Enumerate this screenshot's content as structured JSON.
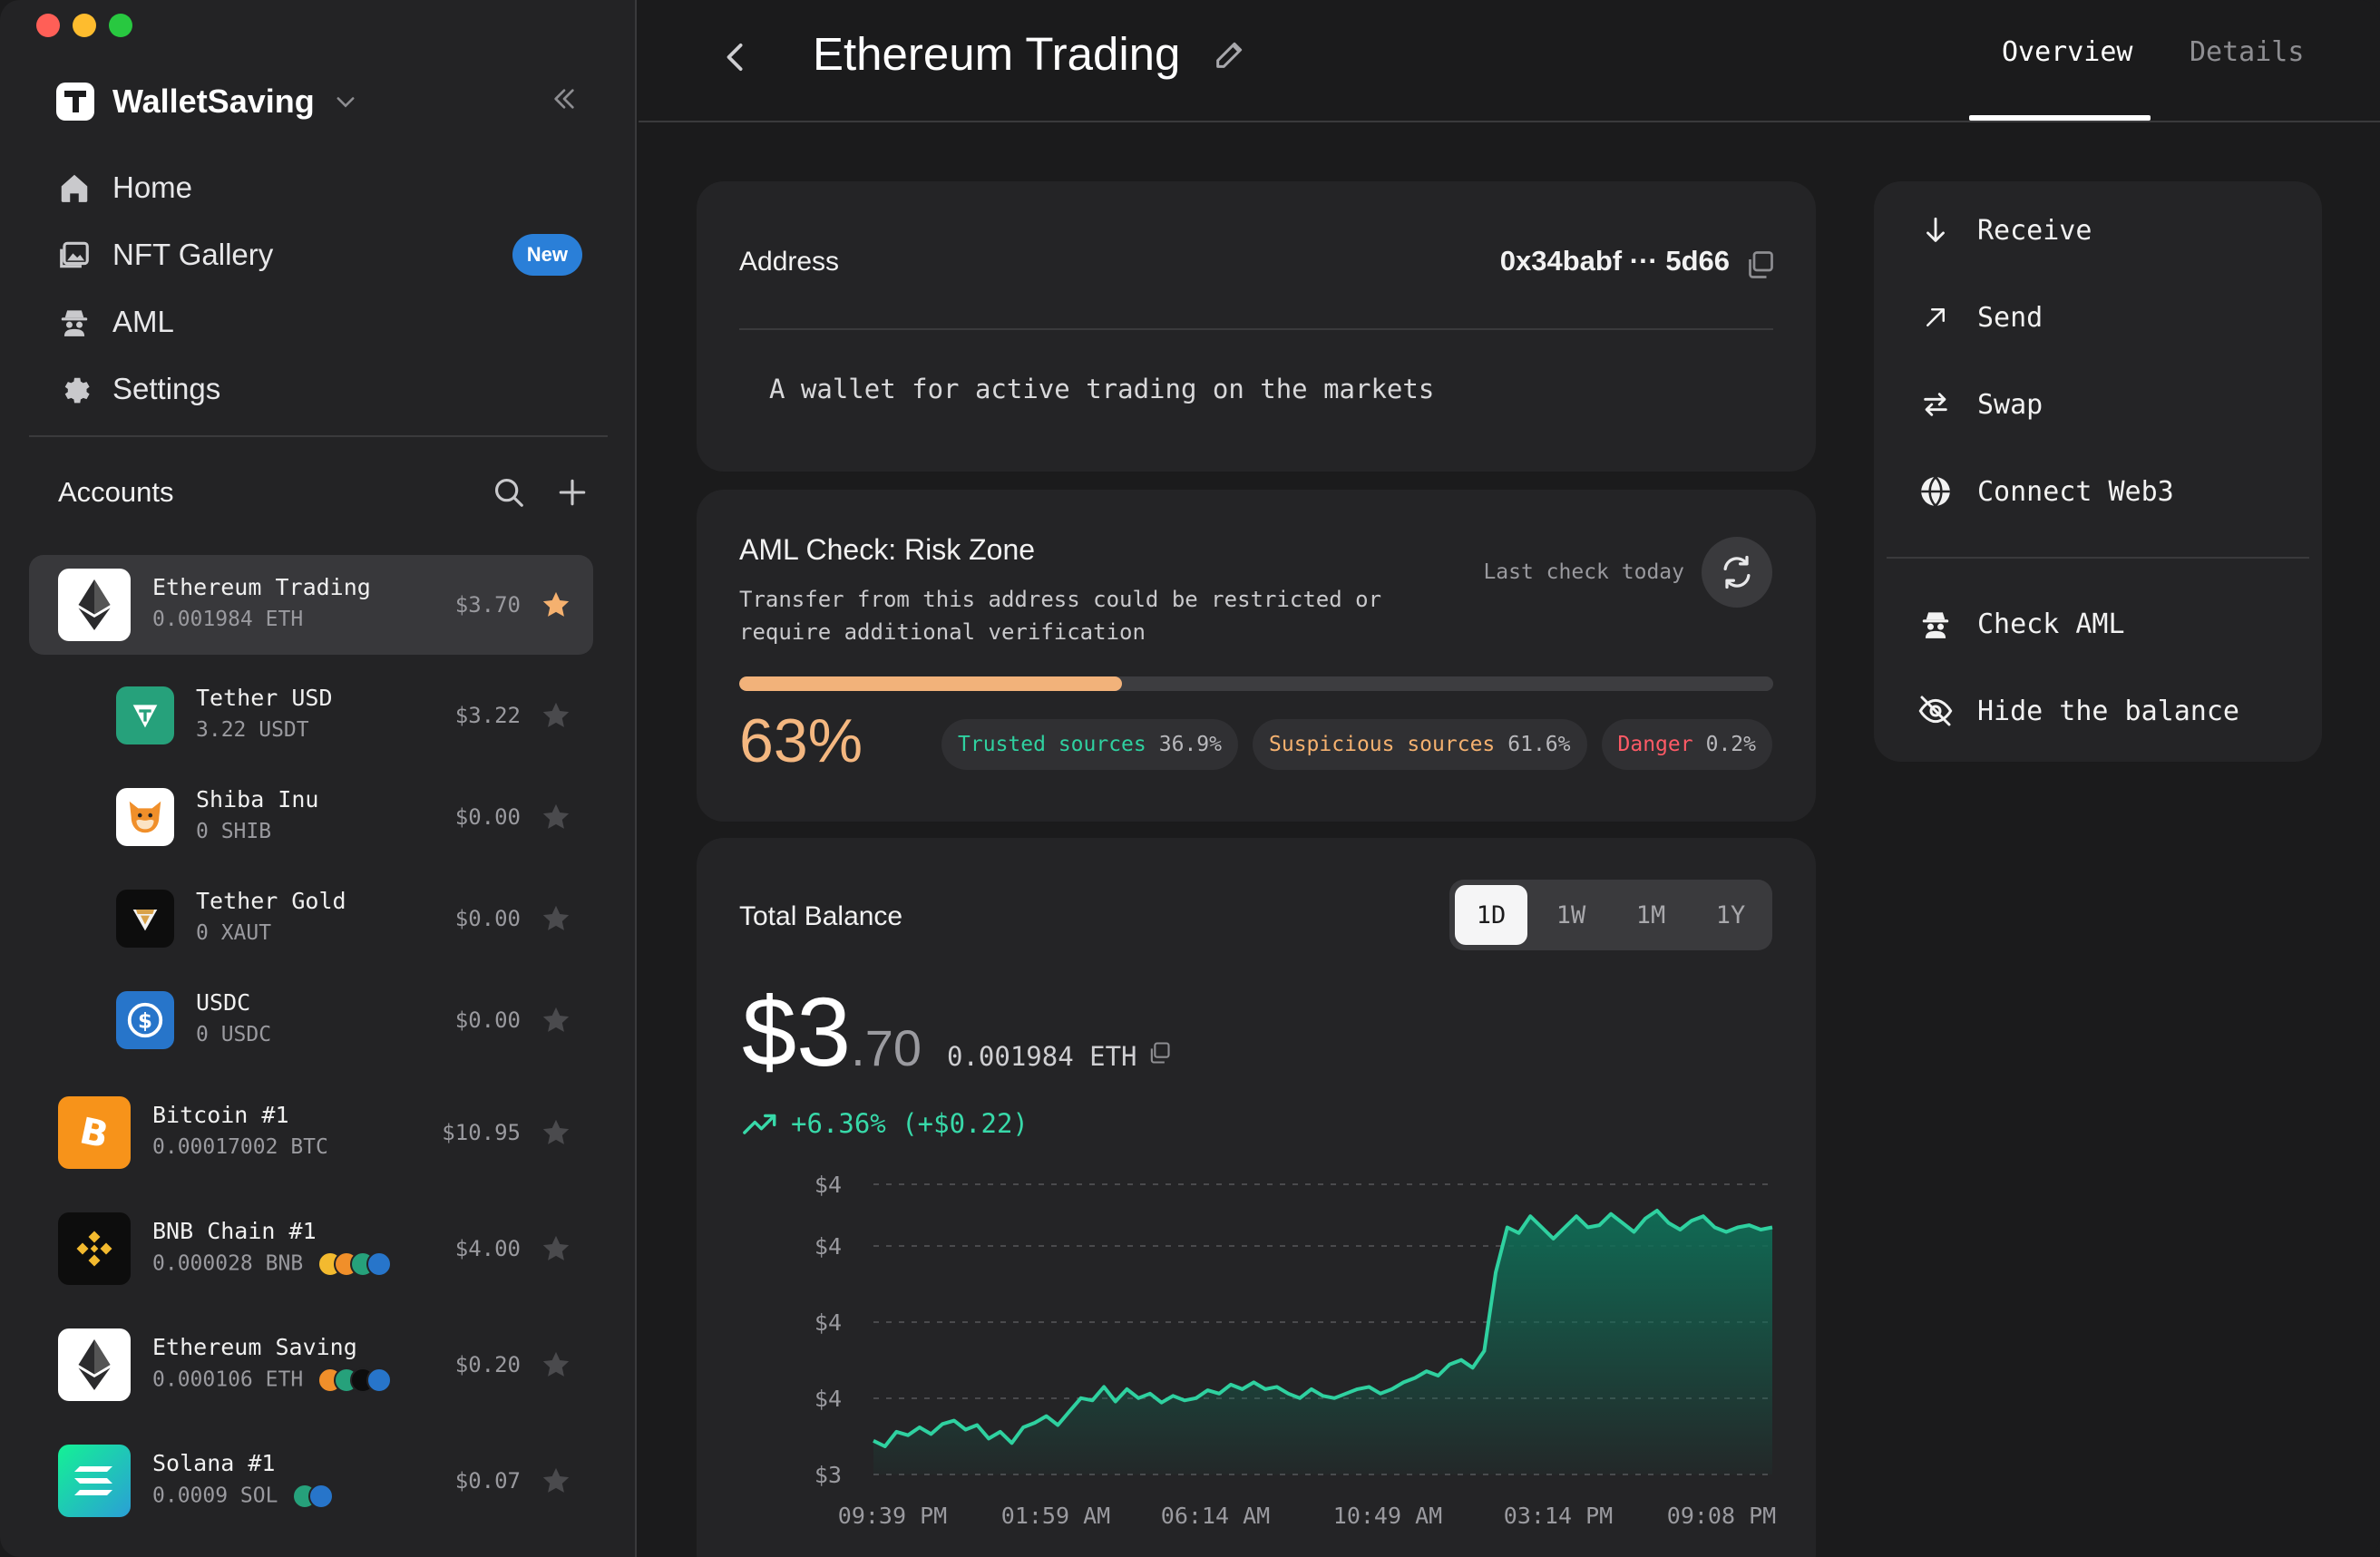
{
  "window": {
    "traffic_lights": [
      "#ff5f57",
      "#febc2e",
      "#28c840"
    ]
  },
  "sidebar": {
    "brand": "WalletSaving",
    "nav": [
      {
        "label": "Home",
        "icon": "home-icon"
      },
      {
        "label": "NFT Gallery",
        "icon": "gallery-icon",
        "badge": "New"
      },
      {
        "label": "AML",
        "icon": "spy-icon"
      },
      {
        "label": "Settings",
        "icon": "gear-icon"
      }
    ],
    "accounts_title": "Accounts",
    "accounts": [
      {
        "name": "Ethereum Trading",
        "amount": "0.001984 ETH",
        "usd": "$3.70",
        "starred": true,
        "active": true
      },
      {
        "name": "Tether USD",
        "amount": "3.22 USDT",
        "usd": "$3.22"
      },
      {
        "name": "Shiba Inu",
        "amount": "0 SHIB",
        "usd": "$0.00"
      },
      {
        "name": "Tether Gold",
        "amount": "0 XAUT",
        "usd": "$0.00"
      },
      {
        "name": "USDC",
        "amount": "0 USDC",
        "usd": "$0.00"
      },
      {
        "name": "Bitcoin #1",
        "amount": "0.00017002 BTC",
        "usd": "$10.95"
      },
      {
        "name": "BNB Chain #1",
        "amount": "0.000028 BNB",
        "usd": "$4.00"
      },
      {
        "name": "Ethereum Saving",
        "amount": "0.000106 ETH",
        "usd": "$0.20"
      },
      {
        "name": "Solana #1",
        "amount": "0.0009 SOL",
        "usd": "$0.07"
      }
    ]
  },
  "header": {
    "title": "Ethereum Trading",
    "tabs": [
      {
        "label": "Overview",
        "active": true
      },
      {
        "label": "Details"
      }
    ]
  },
  "address_card": {
    "label": "Address",
    "value": "0x34babf ··· 5d66",
    "description": "A wallet for active trading on the markets"
  },
  "aml_card": {
    "title": "AML Check: Risk Zone",
    "description": "Transfer from this address could be restricted or require additional verification",
    "last_check": "Last check today",
    "risk_fraction": 0.37,
    "percent": "63%",
    "chips": [
      {
        "label": "Trusted sources",
        "value": "36.9%",
        "color": "#2fd1a0"
      },
      {
        "label": "Suspicious sources",
        "value": "61.6%",
        "color": "#f5b16f"
      },
      {
        "label": "Danger",
        "value": "0.2%",
        "color": "#ff5a66"
      }
    ]
  },
  "balance_card": {
    "label": "Total Balance",
    "ranges": [
      "1D",
      "1W",
      "1M",
      "1Y"
    ],
    "active_range": "1D",
    "balance_int": "$3",
    "balance_dec": ".70",
    "balance_eth": "0.001984 ETH",
    "change": "+6.36% (+$0.22)"
  },
  "chart_data": {
    "type": "area",
    "title": "",
    "xlabel": "",
    "ylabel": "",
    "y_tick_labels": [
      "$4",
      "$4",
      "$4",
      "$4",
      "$3"
    ],
    "x_tick_labels": [
      "09:39 PM",
      "01:59 AM",
      "06:14 AM",
      "10:49 AM",
      "03:14 PM",
      "09:08 PM"
    ],
    "ylim": [
      3.48,
      3.74
    ],
    "grid": true,
    "color": "#2fd1a0",
    "series": [
      {
        "values": [
          3.51,
          3.505,
          3.518,
          3.515,
          3.522,
          3.516,
          3.525,
          3.528,
          3.52,
          3.524,
          3.512,
          3.518,
          3.508,
          3.522,
          3.526,
          3.532,
          3.524,
          3.536,
          3.548,
          3.546,
          3.558,
          3.545,
          3.556,
          3.548,
          3.552,
          3.544,
          3.55,
          3.546,
          3.548,
          3.555,
          3.552,
          3.56,
          3.556,
          3.562,
          3.556,
          3.558,
          3.552,
          3.548,
          3.556,
          3.55,
          3.548,
          3.552,
          3.556,
          3.558,
          3.552,
          3.556,
          3.562,
          3.566,
          3.572,
          3.568,
          3.578,
          3.582,
          3.575,
          3.59,
          3.66,
          3.7,
          3.695,
          3.71,
          3.7,
          3.69,
          3.7,
          3.71,
          3.7,
          3.702,
          3.712,
          3.704,
          3.696,
          3.708,
          3.715,
          3.704,
          3.698,
          3.706,
          3.71,
          3.7,
          3.696,
          3.7,
          3.702,
          3.698,
          3.7
        ]
      }
    ]
  },
  "actions": [
    {
      "label": "Receive",
      "icon": "arrow-down-icon"
    },
    {
      "label": "Send",
      "icon": "arrow-up-right-icon"
    },
    {
      "label": "Swap",
      "icon": "swap-icon"
    },
    {
      "label": "Connect Web3",
      "icon": "globe-icon"
    },
    {
      "label": "Check AML",
      "icon": "spy-icon"
    },
    {
      "label": "Hide the balance",
      "icon": "eye-off-icon"
    }
  ]
}
